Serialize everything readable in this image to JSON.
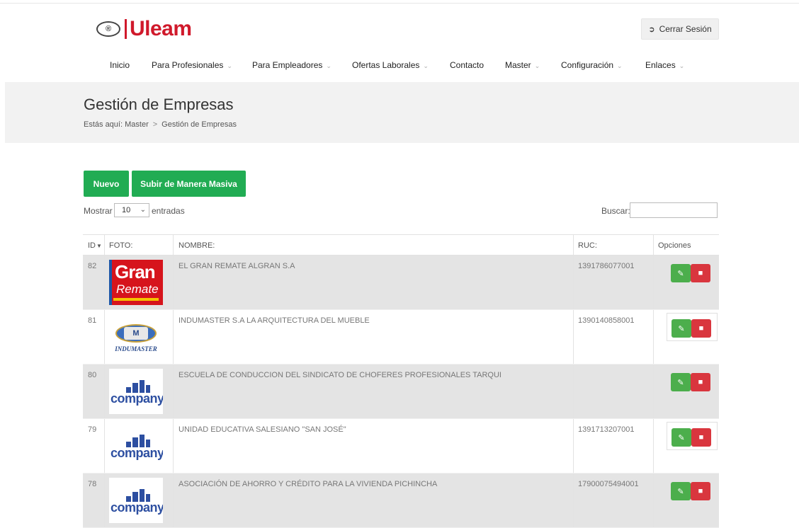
{
  "brand": {
    "name": "Uleam",
    "emblem": "®"
  },
  "header": {
    "logout_label": "Cerrar Sesión",
    "logout_icon": "sign-out-icon"
  },
  "nav": [
    {
      "label": "Inicio",
      "dropdown": false
    },
    {
      "label": "Para Profesionales",
      "dropdown": true
    },
    {
      "label": "Para Empleadores",
      "dropdown": true
    },
    {
      "label": "Ofertas Laborales",
      "dropdown": true
    },
    {
      "label": "Contacto",
      "dropdown": false
    },
    {
      "label": "Master",
      "dropdown": true
    },
    {
      "label": "Configuración",
      "dropdown": true
    },
    {
      "label": "Enlaces",
      "dropdown": true
    }
  ],
  "page": {
    "title": "Gestión de Empresas",
    "breadcrumb": {
      "prefix": "Estás aquí:",
      "items": [
        "Master",
        "Gestión de Empresas"
      ]
    }
  },
  "actions": {
    "new_label": "Nuevo",
    "mass_upload_label": "Subir de Manera Masiva"
  },
  "table_controls": {
    "show_label": "Mostrar",
    "page_size": "10",
    "entries_label": "entradas",
    "search_label": "Buscar:",
    "search_value": ""
  },
  "table": {
    "columns": [
      "ID",
      "FOTO:",
      "NOMBRE:",
      "RUC:",
      "Opciones"
    ],
    "rows": [
      {
        "id": "82",
        "logo": "gran-remate",
        "logo_text": [
          "Gran",
          "Remate"
        ],
        "name": "EL GRAN REMATE ALGRAN S.A",
        "ruc": "1391786077001"
      },
      {
        "id": "81",
        "logo": "indumaster",
        "logo_text": [
          "M",
          "INDUMASTER"
        ],
        "name": "INDUMASTER S.A LA ARQUITECTURA DEL MUEBLE",
        "ruc": "1390140858001"
      },
      {
        "id": "80",
        "logo": "company",
        "logo_text": [
          "company"
        ],
        "name": "ESCUELA DE CONDUCCION DEL SINDICATO DE CHOFERES PROFESIONALES TARQUI",
        "ruc": ""
      },
      {
        "id": "79",
        "logo": "company",
        "logo_text": [
          "company"
        ],
        "name": "UNIDAD EDUCATIVA SALESIANO \"SAN JOSÉ\"",
        "ruc": "1391713207001"
      },
      {
        "id": "78",
        "logo": "company",
        "logo_text": [
          "company"
        ],
        "name": "ASOCIACIÓN DE AHORRO Y CRÉDITO PARA LA VIVIENDA PICHINCHA",
        "ruc": "17900075494001"
      }
    ]
  },
  "colors": {
    "brand_red": "#d0192b",
    "action_green": "#21ac53",
    "edit_green": "#4cae4c",
    "delete_red": "#d9363e"
  }
}
